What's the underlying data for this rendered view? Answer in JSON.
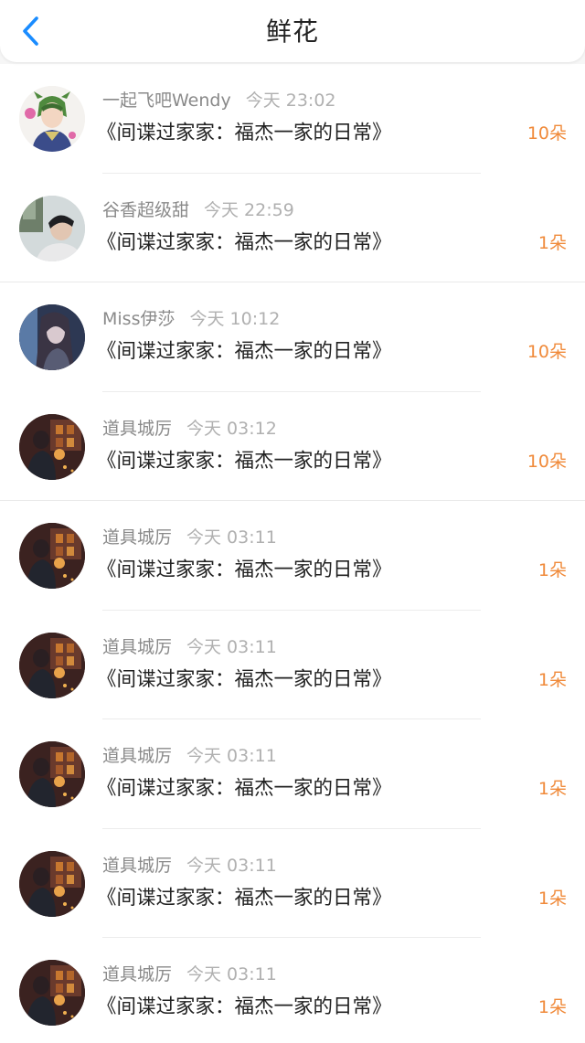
{
  "header": {
    "title": "鲜花",
    "back_icon": "chevron-left-icon",
    "accent": "#1a8cff"
  },
  "colors": {
    "count": "#f08a3a",
    "username": "#8a8a8a",
    "time": "#b0b0b0"
  },
  "items": [
    {
      "user": "一起飞吧Wendy",
      "time": "今天 23:02",
      "book": "《间谍过家家：福杰一家的日常》",
      "count": "10朵",
      "avatar": "anime-character-avatar"
    },
    {
      "user": "谷香超级甜",
      "time": "今天 22:59",
      "book": "《间谍过家家：福杰一家的日常》",
      "count": "1朵",
      "avatar": "person-photo-avatar"
    },
    {
      "user": "Miss伊莎",
      "time": "今天 10:12",
      "book": "《间谍过家家：福杰一家的日常》",
      "count": "10朵",
      "avatar": "dark-haired-girl-avatar"
    },
    {
      "user": "道具城厉",
      "time": "今天 03:12",
      "book": "《间谍过家家：福杰一家的日常》",
      "count": "10朵",
      "avatar": "dark-room-figure-avatar"
    },
    {
      "user": "道具城厉",
      "time": "今天 03:11",
      "book": "《间谍过家家：福杰一家的日常》",
      "count": "1朵",
      "avatar": "dark-room-figure-avatar"
    },
    {
      "user": "道具城厉",
      "time": "今天 03:11",
      "book": "《间谍过家家：福杰一家的日常》",
      "count": "1朵",
      "avatar": "dark-room-figure-avatar"
    },
    {
      "user": "道具城厉",
      "time": "今天 03:11",
      "book": "《间谍过家家：福杰一家的日常》",
      "count": "1朵",
      "avatar": "dark-room-figure-avatar"
    },
    {
      "user": "道具城厉",
      "time": "今天 03:11",
      "book": "《间谍过家家：福杰一家的日常》",
      "count": "1朵",
      "avatar": "dark-room-figure-avatar"
    },
    {
      "user": "道具城厉",
      "time": "今天 03:11",
      "book": "《间谍过家家：福杰一家的日常》",
      "count": "1朵",
      "avatar": "dark-room-figure-avatar"
    }
  ]
}
